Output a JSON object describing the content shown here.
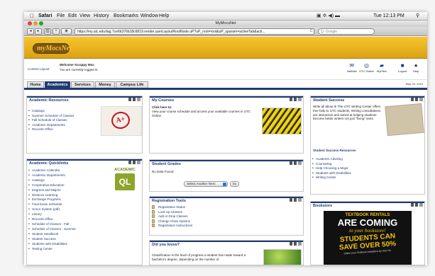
{
  "os_menubar": {
    "apple": "",
    "app": "Safari",
    "items": [
      "File",
      "Edit",
      "View",
      "History",
      "Bookmarks",
      "Window",
      "Help"
    ],
    "clock": "Tue 12:13 PM"
  },
  "browser": {
    "window_title": "MyMocsNet",
    "url": "https://my.utc.edu/tag.7ce6b376b18c6819.render.userLayoutRootNode.uP?uP_root=root&uP_sparam=activeTab&acti...",
    "url_suffix": "C",
    "search_placeholder": "Q- Google"
  },
  "site": {
    "logo": "myMocsNet"
  },
  "userbar": {
    "content_layout": "Content Layout",
    "welcome": "Welcome Scrappy Moc",
    "logged_in": "You are currently logged in.",
    "date": "May 25, 2010"
  },
  "quick_icons": [
    "NetMail",
    "UTC Online",
    "MyFiles",
    "Logout",
    "Help"
  ],
  "tabs": [
    "Home",
    "Academics",
    "Services",
    "Money",
    "Campus Life"
  ],
  "active_tab": "Academics",
  "academic_resources": {
    "title": "Academic Resources",
    "items": [
      "Catalogs",
      "Summer Schedule of Classes",
      "Fall Schedule of Classes",
      "Academic Departments",
      "Records Office"
    ]
  },
  "my_courses": {
    "title": "My Courses",
    "link": "Click here to:",
    "text": "View your course schedule and access your available courses in UTC Online."
  },
  "student_success": {
    "title": "Student Success",
    "text": "Write all about it! The UTC Writing Center offers free help to UTC students. Writing consultations are interactive and aimed at helping students become better writers not just \"fixing\" texts.",
    "resources_title": "Student Success Resources",
    "items": [
      "Academic Advising",
      "Counseling",
      "Help Choosing a Major",
      "Students with Disabilities",
      "Writing Center"
    ]
  },
  "academic_quicklinks": {
    "title": "Academic Quicklinks",
    "badge_top": "ACADEMIC",
    "badge_bottom": "QL",
    "items": [
      "Academic Calendar",
      "Academic Departments",
      "Catalogs",
      "Cooperative Education",
      "Degrees and Majors",
      "Distance Learning",
      "Exchange Programs",
      "Final Exam Schedule",
      "Honor System (pdf)",
      "Library",
      "Records Office",
      "Schedule of Classes - Fall",
      "Schedule of Classes - Summer",
      "Student Handbook",
      "Student Success",
      "Students with Disabilities",
      "Testing Center"
    ]
  },
  "student_grades": {
    "title": "Student Grades",
    "empty": "No Data Found",
    "select": "Select Another Term",
    "go": "Go"
  },
  "registration_tools": {
    "title": "Registration Tools",
    "items": [
      "Registration Status",
      "Look Up Classes",
      "Add or Drop Classes",
      "Change Class Options",
      "Registration Instructions"
    ]
  },
  "did_you_know": {
    "title": "Did you know?",
    "text": "Classification is the level of progress a student has made toward a bachelor's degree, depending on the number of"
  },
  "bookstore": {
    "title": "Bookstore",
    "ad_line1": "TEXTBOOK RENTALS",
    "ad_line2": "ARE COMING",
    "ad_line3": "to your bookstore!",
    "ad_line4": "STUDENTS CAN",
    "ad_line5": "SAVE OVER 50%",
    "ad_line6": "Select your Textbook Adoptions by July 1st."
  },
  "colors": {
    "navy": "#1f3b73",
    "gold": "#e8b321",
    "bookstore_ad": "#111111",
    "ad_gold": "#f2c415"
  }
}
